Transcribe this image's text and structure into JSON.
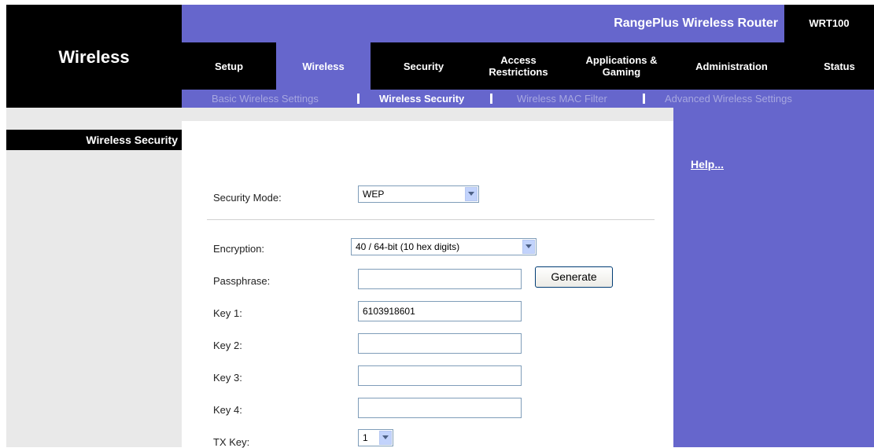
{
  "header": {
    "page_title": "Wireless",
    "product_name": "RangePlus Wireless Router",
    "model": "WRT100"
  },
  "nav": {
    "tabs": [
      {
        "label": "Setup"
      },
      {
        "label": "Wireless"
      },
      {
        "label": "Security"
      },
      {
        "label": "Access Restrictions"
      },
      {
        "label": "Applications & Gaming"
      },
      {
        "label": "Administration"
      },
      {
        "label": "Status"
      }
    ],
    "active_tab": "Wireless"
  },
  "subnav": {
    "items": [
      {
        "label": "Basic Wireless Settings"
      },
      {
        "label": "Wireless Security"
      },
      {
        "label": "Wireless MAC Filter"
      },
      {
        "label": "Advanced Wireless Settings"
      }
    ],
    "active_item": "Wireless Security"
  },
  "sidebar": {
    "section_title": "Wireless Security"
  },
  "help": {
    "label": "Help..."
  },
  "form": {
    "security_mode": {
      "label": "Security Mode:",
      "value": "WEP"
    },
    "encryption": {
      "label": "Encryption:",
      "value": "40 / 64-bit (10 hex digits)"
    },
    "passphrase": {
      "label": "Passphrase:",
      "value": ""
    },
    "generate_label": "Generate",
    "key1": {
      "label": "Key 1:",
      "value": "6103918601"
    },
    "key2": {
      "label": "Key 2:",
      "value": ""
    },
    "key3": {
      "label": "Key 3:",
      "value": ""
    },
    "key4": {
      "label": "Key 4:",
      "value": ""
    },
    "tx_key": {
      "label": "TX Key:",
      "value": "1"
    }
  },
  "colors": {
    "accent": "#6666cc",
    "header_black": "#000000",
    "sidebar_gray": "#e9e9e9",
    "inactive_subnav": "#a7a7e0"
  },
  "icons": {
    "dropdown": "chevron-down-icon"
  }
}
